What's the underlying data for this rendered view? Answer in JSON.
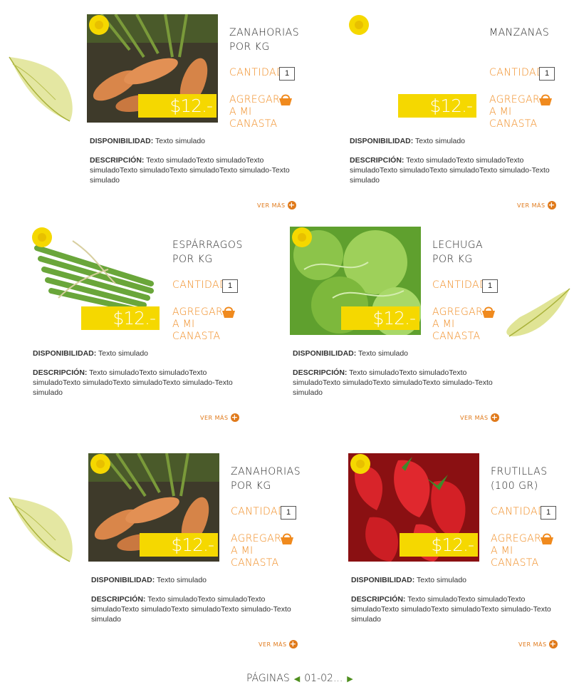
{
  "colors": {
    "accent": "#f08a1e",
    "price_bg": "#f5d800",
    "text": "#2a2a2a",
    "leaf": "#b8c23a"
  },
  "products": [
    {
      "name": "ZANAHORIAS",
      "unit": "POR KG",
      "qty_label": "CANTIDAD",
      "qty": "1",
      "price": "$12.-",
      "add_line1": "AGREGAR",
      "add_line2": "A MI CANASTA",
      "avail_label": "DISPONIBILIDAD:",
      "avail_value": "Texto simulado",
      "desc_label": "DESCRIPCIÓN:",
      "desc_value": "Texto simuladoTexto simuladoTexto simuladoTexto simuladoTexto simuladoTexto simulado-Texto simulado",
      "more": "VER MÁS",
      "image": "carrots"
    },
    {
      "name": "MANZANAS",
      "unit": "",
      "qty_label": "CANTIDAD",
      "qty": "1",
      "price": "$12.-",
      "add_line1": "AGREGAR",
      "add_line2": "A MI CANASTA",
      "avail_label": "DISPONIBILIDAD:",
      "avail_value": "Texto simulado",
      "desc_label": "DESCRIPCIÓN:",
      "desc_value": "Texto simuladoTexto simuladoTexto simuladoTexto simuladoTexto simuladoTexto simulado-Texto simulado",
      "more": "VER MÁS",
      "image": "none"
    },
    {
      "name": "ESPÁRRAGOS",
      "unit": "POR KG",
      "qty_label": "CANTIDAD",
      "qty": "1",
      "price": "$12.-",
      "add_line1": "AGREGAR",
      "add_line2": "A MI CANASTA",
      "avail_label": "DISPONIBILIDAD:",
      "avail_value": "Texto simulado",
      "desc_label": "DESCRIPCIÓN:",
      "desc_value": "Texto simuladoTexto simuladoTexto simuladoTexto simuladoTexto simuladoTexto simulado-Texto simulado",
      "more": "VER MÁS",
      "image": "asparagus"
    },
    {
      "name": "LECHUGA",
      "unit": "POR KG",
      "qty_label": "CANTIDAD",
      "qty": "1",
      "price": "$12.-",
      "add_line1": "AGREGAR",
      "add_line2": "A MI CANASTA",
      "avail_label": "DISPONIBILIDAD:",
      "avail_value": "Texto simulado",
      "desc_label": "DESCRIPCIÓN:",
      "desc_value": "Texto simuladoTexto simuladoTexto simuladoTexto simuladoTexto simuladoTexto simulado-Texto simulado",
      "more": "VER MÁS",
      "image": "lettuce"
    },
    {
      "name": "ZANAHORIAS",
      "unit": "POR KG",
      "qty_label": "CANTIDAD",
      "qty": "1",
      "price": "$12.-",
      "add_line1": "AGREGAR",
      "add_line2": "A MI CANASTA",
      "avail_label": "DISPONIBILIDAD:",
      "avail_value": "Texto simulado",
      "desc_label": "DESCRIPCIÓN:",
      "desc_value": "Texto simuladoTexto simuladoTexto simuladoTexto simuladoTexto simuladoTexto simulado-Texto simulado",
      "more": "VER MÁS",
      "image": "carrots"
    },
    {
      "name": "FRUTILLAS",
      "unit": "(100 GR)",
      "qty_label": "CANTIDAD",
      "qty": "1",
      "price": "$12.-",
      "add_line1": "AGREGAR",
      "add_line2": "A MI CANASTA",
      "avail_label": "DISPONIBILIDAD:",
      "avail_value": "Texto simulado",
      "desc_label": "DESCRIPCIÓN:",
      "desc_value": "Texto simuladoTexto simuladoTexto simuladoTexto simuladoTexto simuladoTexto simulado-Texto simulado",
      "more": "VER MÁS",
      "image": "strawberries"
    }
  ],
  "pager": {
    "label": "PÁGINAS",
    "pages": "01-02..."
  }
}
